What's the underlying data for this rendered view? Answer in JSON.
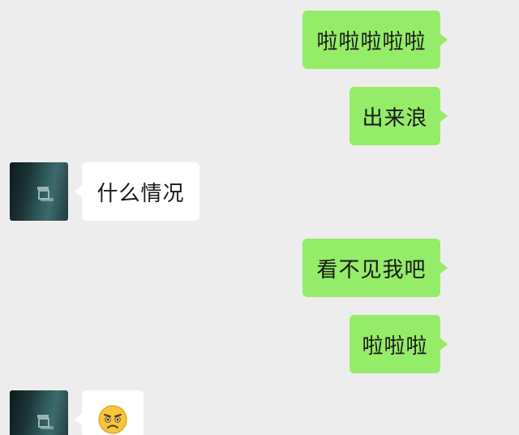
{
  "messages": [
    {
      "side": "out",
      "text": "啦啦啦啦啦"
    },
    {
      "side": "out",
      "text": "出来浪"
    },
    {
      "side": "in",
      "text": "什么情况"
    },
    {
      "side": "out",
      "text": "看不见我吧"
    },
    {
      "side": "out",
      "text": "啦啦啦"
    },
    {
      "side": "in",
      "emoji": "frowning-face-emoji"
    }
  ],
  "colors": {
    "background": "#ededed",
    "outgoing_bubble": "#95ec69",
    "incoming_bubble": "#ffffff",
    "text": "#191919"
  }
}
